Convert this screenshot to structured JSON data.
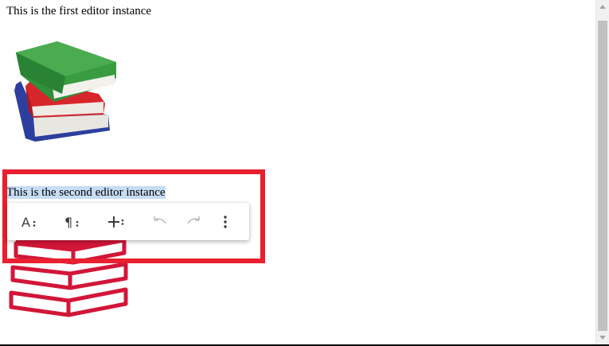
{
  "editors": [
    {
      "text": "This is the first editor instance",
      "image": "books-stack-color"
    },
    {
      "text": "This is the second editor instance",
      "image": "books-stack-red"
    }
  ],
  "toolbar": {
    "buttons": [
      {
        "name": "text-format",
        "icon": "text-format-icon"
      },
      {
        "name": "paragraph",
        "icon": "paragraph-icon"
      },
      {
        "name": "insert",
        "icon": "plus-icon"
      },
      {
        "name": "undo",
        "icon": "undo-icon"
      },
      {
        "name": "redo",
        "icon": "redo-icon"
      },
      {
        "name": "more",
        "icon": "more-vertical-icon"
      }
    ]
  },
  "colors": {
    "highlight_border": "#e8202f",
    "selection": "#c7dcf5",
    "toolbar_icon": "#3c3c3c",
    "toolbar_icon_disabled": "#bdbdbd"
  }
}
